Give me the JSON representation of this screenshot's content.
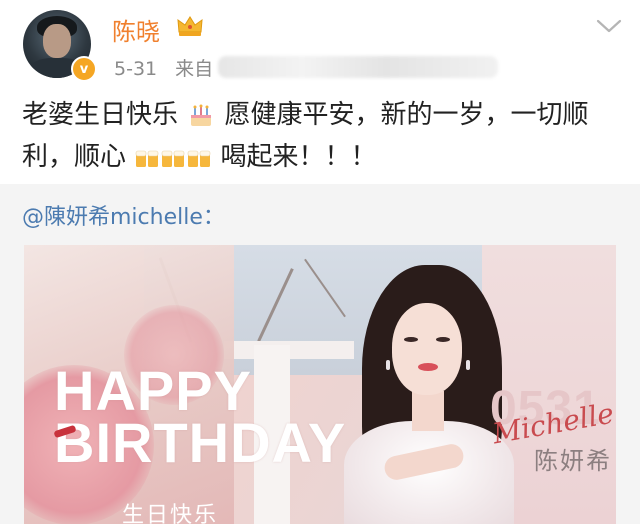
{
  "post": {
    "username": "陈晓",
    "date": "5-31",
    "source_prefix": "来自",
    "text_part1": "老婆生日快乐",
    "text_part2": "愿健康平安，新的一岁，一切顺利，顺心",
    "text_part3": "喝起来！！！",
    "emoji_cake": "cake-icon",
    "emoji_beer": "beer-icon"
  },
  "repost": {
    "user": "@陳妍希michelle："
  },
  "banner": {
    "happy": "HAPPY",
    "birthday": "BIRTHDAY",
    "cn_wish": "生日快乐",
    "number": "0531",
    "signature": "Michelle",
    "cn_name": "陈妍希"
  },
  "colors": {
    "username": "#f0802e",
    "link": "#4c7bb0",
    "verified_badge": "#f5a623"
  }
}
